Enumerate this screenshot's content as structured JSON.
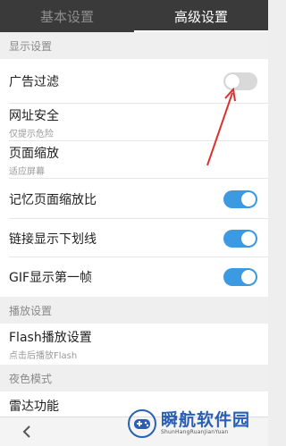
{
  "tabs": [
    {
      "label": "基本设置",
      "active": false
    },
    {
      "label": "高级设置",
      "active": true
    }
  ],
  "sections": {
    "display": "显示设置",
    "playback": "播放设置",
    "night": "夜色模式"
  },
  "settings": {
    "ad_filter": {
      "label": "广告过滤",
      "toggle": "off"
    },
    "url_security": {
      "label": "网址安全",
      "subtitle": "仅提示危险"
    },
    "page_zoom": {
      "label": "页面缩放",
      "subtitle": "适应屏幕"
    },
    "remember_zoom": {
      "label": "记忆页面缩放比",
      "toggle": "on"
    },
    "link_underline": {
      "label": "链接显示下划线",
      "toggle": "on"
    },
    "gif_first_frame": {
      "label": "GIF显示第一帧",
      "toggle": "on"
    },
    "flash_playback": {
      "label": "Flash播放设置",
      "subtitle": "点击后播放Flash"
    },
    "radar": {
      "label": "雷达功能"
    }
  },
  "watermark": {
    "title": "瞬航软件园",
    "subtitle": "ShunHangRuanJianYuan"
  },
  "colors": {
    "tabbar_bg": "#3a3a3a",
    "toggle_on": "#3b9ae1",
    "toggle_off": "#d9d9d9",
    "annotation_arrow": "#d9322e",
    "watermark_blue": "#2b5fb3"
  },
  "icons": {
    "back": "chevron-left-icon",
    "annotation": "red-arrow-annotation",
    "watermark_logo": "gamepad-logo-icon"
  }
}
